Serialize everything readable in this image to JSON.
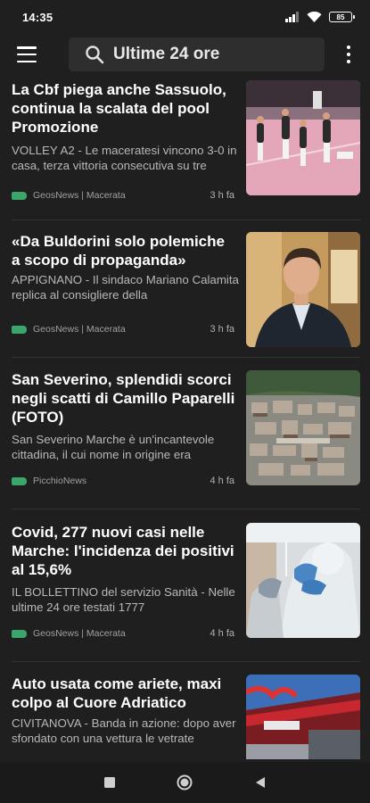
{
  "status": {
    "time": "14:35",
    "battery": "85"
  },
  "search": {
    "query": "Ultime 24 ore"
  },
  "articles": [
    {
      "title": "La Cbf piega anche Sassuolo, continua la scalata del pool Promozione",
      "snippet": "VOLLEY A2 - Le maceratesi vincono 3-0 in casa, terza vittoria consecutiva su tre",
      "source": "GeosNews | Macerata",
      "age": "3 h fa",
      "thumb": "volleyball-photo"
    },
    {
      "title": "«Da Buldorini solo polemiche  a scopo di propaganda»",
      "snippet": "APPIGNANO - Il sindaco Mariano Calamita replica al consigliere della",
      "source": "GeosNews | Macerata",
      "age": "3 h fa",
      "thumb": "portrait-photo"
    },
    {
      "title": "San Severino, splendidi scorci negli scatti di Camillo Paparelli (FOTO)",
      "snippet": "San Severino Marche è un'incantevole cittadina, il cui nome in origine era",
      "source": "PicchioNews",
      "age": "4 h fa",
      "thumb": "town-aerial-photo"
    },
    {
      "title": "Covid, 277 nuovi casi nelle Marche:  l'incidenza dei positivi al 15,6%",
      "snippet": "IL BOLLETTINO del servizio Sanità - Nelle ultime 24 ore testati 1777",
      "source": "GeosNews | Macerata",
      "age": "4 h fa",
      "thumb": "covid-test-photo"
    },
    {
      "title": "Auto usata come ariete,  maxi colpo al Cuore Adriatico",
      "snippet": "CIVITANOVA - Banda in azione: dopo aver sfondato con una vettura le vetrate",
      "source": "",
      "age": "",
      "thumb": "mall-photo"
    }
  ],
  "colors": {
    "background": "#1f1f1f",
    "tag": "#3aa66b",
    "snippet": "#b8b8b8"
  }
}
